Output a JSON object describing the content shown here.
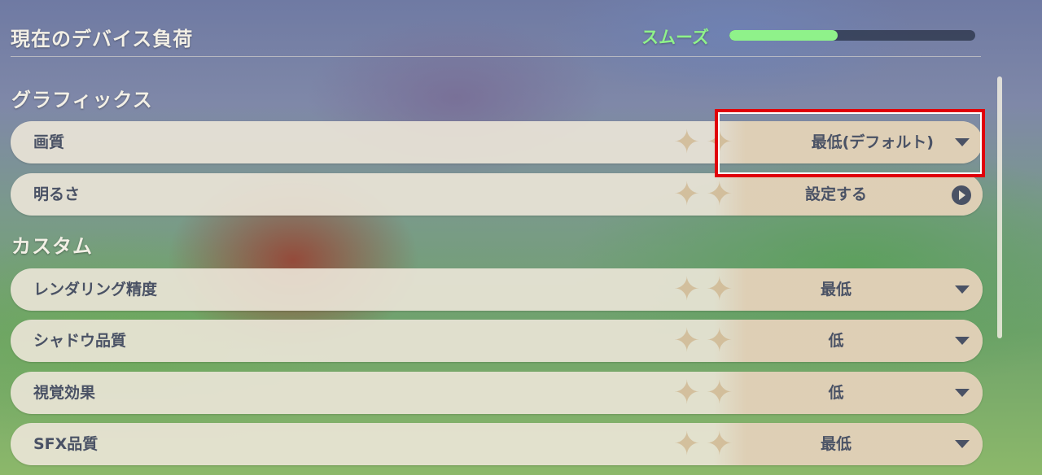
{
  "header": {
    "title": "現在のデバイス負荷",
    "load_status": "スムーズ",
    "load_level": 0.44,
    "load_color": "#8ff28a"
  },
  "sections": {
    "graphics": {
      "title": "グラフィックス",
      "quality": {
        "label": "画質",
        "value": "最低(デフォルト)"
      },
      "brightness": {
        "label": "明るさ",
        "value": "設定する"
      }
    },
    "custom": {
      "title": "カスタム",
      "render_resolution": {
        "label": "レンダリング精度",
        "value": "最低"
      },
      "shadow_quality": {
        "label": "シャドウ品質",
        "value": "低"
      },
      "visual_effects": {
        "label": "視覚効果",
        "value": "低"
      },
      "sfx_quality": {
        "label": "SFX品質",
        "value": "最低"
      }
    }
  },
  "highlight_color": "#e0000b",
  "icons": {
    "dropdown": "triangle-down",
    "go": "circled-play-arrow"
  }
}
